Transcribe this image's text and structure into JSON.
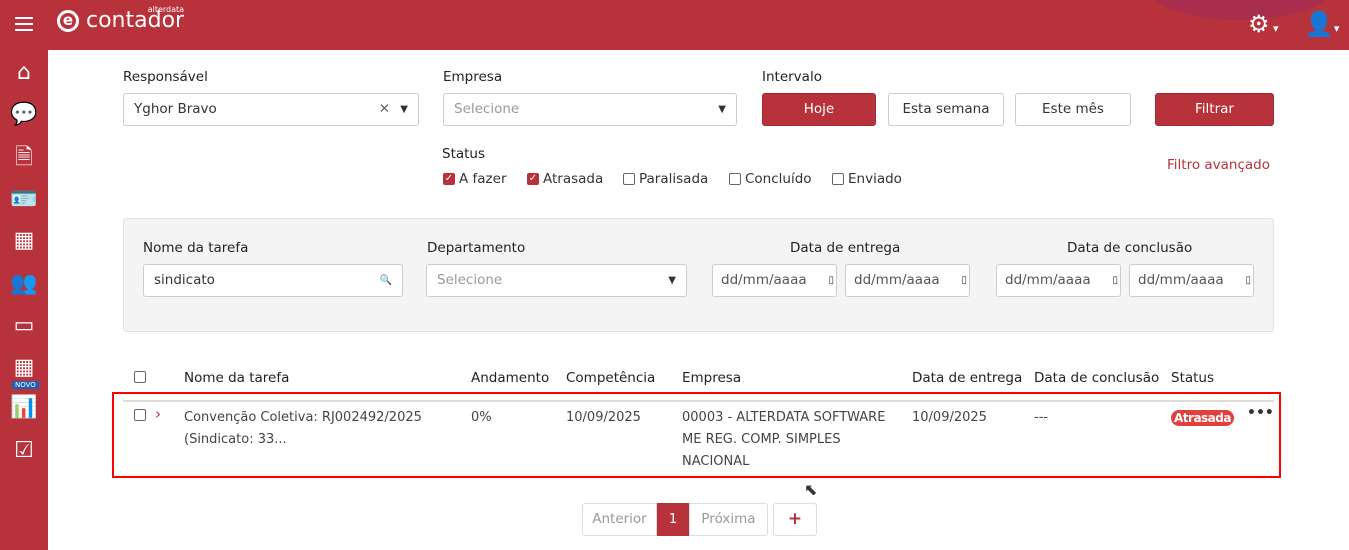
{
  "header": {
    "brand": "contador",
    "brand_small": "alterdata",
    "logo_letter": "e"
  },
  "sidebar": {
    "items": [
      {
        "icon": "home-icon",
        "g": "⌂"
      },
      {
        "icon": "chat-icon",
        "g": "💬"
      },
      {
        "icon": "document-icon",
        "g": "🗎"
      },
      {
        "icon": "id-card-icon",
        "g": "🪪"
      },
      {
        "icon": "building-icon",
        "g": "▦"
      },
      {
        "icon": "users-icon",
        "g": "👥"
      },
      {
        "icon": "credit-card-icon",
        "g": "▭"
      },
      {
        "icon": "calculator-icon",
        "g": "▦"
      },
      {
        "icon": "bar-chart-icon",
        "g": "📊"
      },
      {
        "icon": "checkbox-icon",
        "g": "☑"
      }
    ],
    "badge": "NOVO"
  },
  "filters": {
    "responsavel_label": "Responsável",
    "responsavel_value": "Yghor Bravo",
    "empresa_label": "Empresa",
    "empresa_placeholder": "Selecione",
    "intervalo_label": "Intervalo",
    "hoje": "Hoje",
    "semana": "Esta semana",
    "mes": "Este mês",
    "filtrar": "Filtrar",
    "status_label": "Status",
    "advanced": "Filtro avançado",
    "status": [
      {
        "label": "A fazer",
        "checked": true
      },
      {
        "label": "Atrasada",
        "checked": true
      },
      {
        "label": "Paralisada",
        "checked": false
      },
      {
        "label": "Concluído",
        "checked": false
      },
      {
        "label": "Enviado",
        "checked": false
      }
    ]
  },
  "advanced": {
    "nome_label": "Nome da tarefa",
    "nome_value": "sindicato",
    "depto_label": "Departamento",
    "depto_placeholder": "Selecione",
    "entrega_label": "Data de entrega",
    "conclusao_label": "Data de conclusão",
    "date_placeholder": "dd/mm/aaaa"
  },
  "table": {
    "headers": [
      "Nome da tarefa",
      "Andamento",
      "Competência",
      "Empresa",
      "Data de entrega",
      "Data de conclusão",
      "Status"
    ],
    "rows": [
      {
        "nome1": "Convenção Coletiva: RJ002492/2025",
        "nome2": "(Sindicato: 33...",
        "andamento": "0%",
        "competencia": "10/09/2025",
        "empresa1": "00003 - ALTERDATA SOFTWARE",
        "empresa2": "ME REG. COMP. SIMPLES",
        "empresa3": "NACIONAL",
        "entrega": "10/09/2025",
        "conclusao": "---",
        "status": "Atrasada"
      }
    ]
  },
  "pagination": {
    "prev": "Anterior",
    "page": "1",
    "next": "Próxima",
    "add": "+"
  },
  "colors": {
    "brand": "#b8323b",
    "status_late": "#e0413c",
    "highlight": "#ff0000"
  }
}
